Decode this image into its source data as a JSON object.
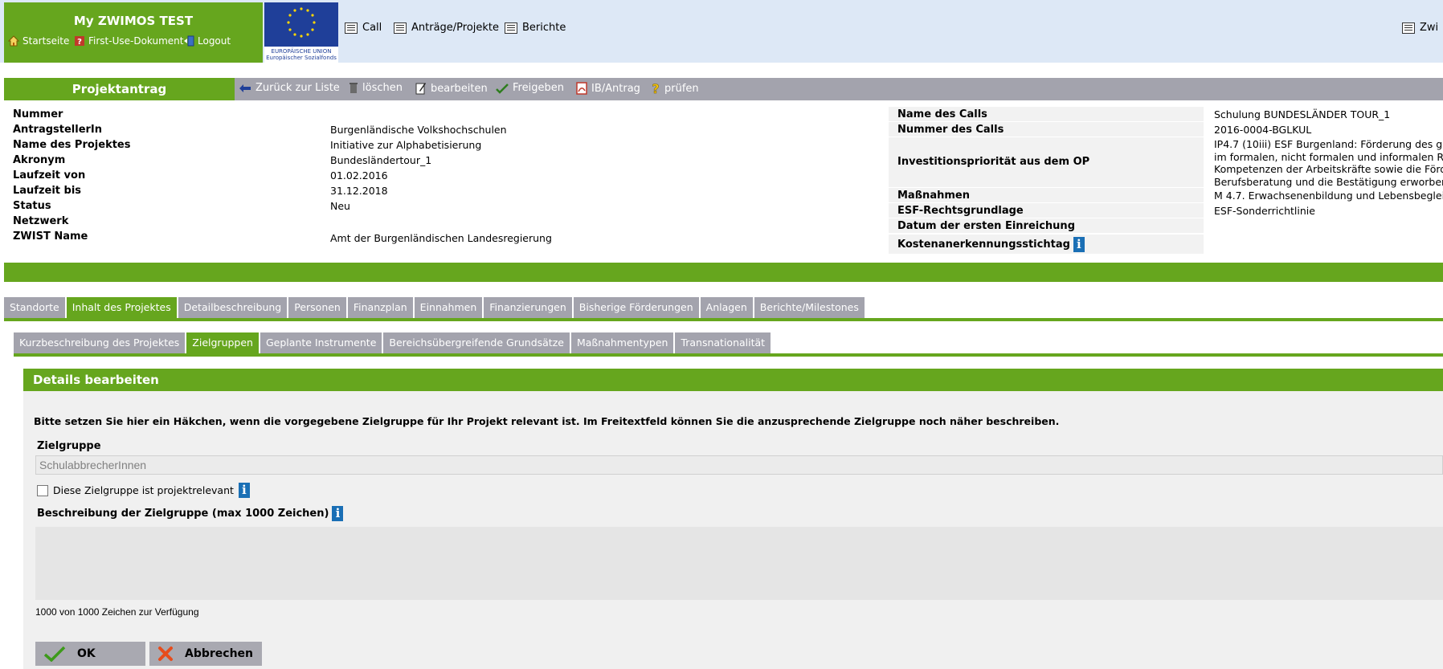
{
  "header": {
    "app_title": "My ZWIMOS TEST",
    "links": [
      "Startseite",
      "First-Use-Dokument",
      "Logout"
    ],
    "eu_caption_line1": "EUROPÄISCHE UNION",
    "eu_caption_line2": "Europäischer Sozialfonds",
    "nav": [
      "Call",
      "Anträge/Projekte",
      "Berichte"
    ],
    "nav_right": "Zwi"
  },
  "action_bar": {
    "title": "Projektantrag",
    "actions": [
      "Zurück zur Liste",
      "löschen",
      "bearbeiten",
      "Freigeben",
      "IB/Antrag",
      "prüfen"
    ]
  },
  "info_left": [
    {
      "label": "Nummer",
      "value": ""
    },
    {
      "label": "AntragstellerIn",
      "value": "Burgenländische Volkshochschulen"
    },
    {
      "label": "Name des Projektes",
      "value": "Initiative zur Alphabetisierung"
    },
    {
      "label": "Akronym",
      "value": "Bundesländertour_1"
    },
    {
      "label": "Laufzeit von",
      "value": "01.02.2016"
    },
    {
      "label": "Laufzeit bis",
      "value": "31.12.2018"
    },
    {
      "label": "Status",
      "value": "Neu"
    },
    {
      "label": "Netzwerk",
      "value": ""
    },
    {
      "label": "ZWIST Name",
      "value": "Amt der Burgenländischen Landesregierung"
    }
  ],
  "info_right": {
    "call_name_label": "Name des Calls",
    "call_name": "Schulung BUNDESLÄNDER TOUR_1",
    "call_number_label": "Nummer des Calls",
    "call_number": "2016-0004-BGLKUL",
    "priority_label": "Investitionspriorität aus dem OP",
    "priority_lines": [
      "IP4.7 (10iii) ESF Burgenland: Förderung des g",
      "im formalen, nicht formalen und informalen R",
      "Kompetenzen der Arbeitskräfte sowie die Förd",
      "Berufsberatung und die Bestätigung erworben"
    ],
    "measures_label": "Maßnahmen",
    "measures": "M 4.7. Erwachsenenbildung und Lebensbeglei",
    "legal_label": "ESF-Rechtsgrundlage",
    "legal": "ESF-Sonderrichtlinie",
    "first_submission_label": "Datum der ersten Einreichung",
    "first_submission": "",
    "cost_date_label": "Kostenanerkennungsstichtag"
  },
  "tabs_main": [
    {
      "label": "Standorte",
      "active": false
    },
    {
      "label": "Inhalt des Projektes",
      "active": true
    },
    {
      "label": "Detailbeschreibung",
      "active": false
    },
    {
      "label": "Personen",
      "active": false
    },
    {
      "label": "Finanzplan",
      "active": false
    },
    {
      "label": "Einnahmen",
      "active": false
    },
    {
      "label": "Finanzierungen",
      "active": false
    },
    {
      "label": "Bisherige Förderungen",
      "active": false
    },
    {
      "label": "Anlagen",
      "active": false
    },
    {
      "label": "Berichte/Milestones",
      "active": false
    }
  ],
  "tabs_sub": [
    {
      "label": "Kurzbeschreibung des Projektes",
      "active": false
    },
    {
      "label": "Zielgruppen",
      "active": true
    },
    {
      "label": "Geplante Instrumente",
      "active": false
    },
    {
      "label": "Bereichsübergreifende Grundsätze",
      "active": false
    },
    {
      "label": "Maßnahmentypen",
      "active": false
    },
    {
      "label": "Transnationalität",
      "active": false
    }
  ],
  "details": {
    "header": "Details bearbeiten",
    "instruction": "Bitte setzen Sie hier ein Häkchen, wenn die vorgegebene Zielgruppe für Ihr Projekt relevant ist. Im Freitextfeld können Sie die anzusprechende Zielgruppe noch näher beschreiben.",
    "target_group_label": "Zielgruppe",
    "target_group_value": "SchulabbrecherInnen",
    "checkbox_label": "Diese Zielgruppe ist projektrelevant",
    "checkbox_checked": false,
    "description_label": "Beschreibung der Zielgruppe (max 1000 Zeichen)",
    "description_value": "",
    "char_count": "1000",
    "char_count_suffix": "von 1000 Zeichen zur Verfügung",
    "ok_label": "OK",
    "cancel_label": "Abbrechen"
  },
  "colors": {
    "green": "#66a61e",
    "gray_bar": "#a3a3ad",
    "header_blue": "#dde8f6",
    "info_blue": "#1a6fb5"
  }
}
